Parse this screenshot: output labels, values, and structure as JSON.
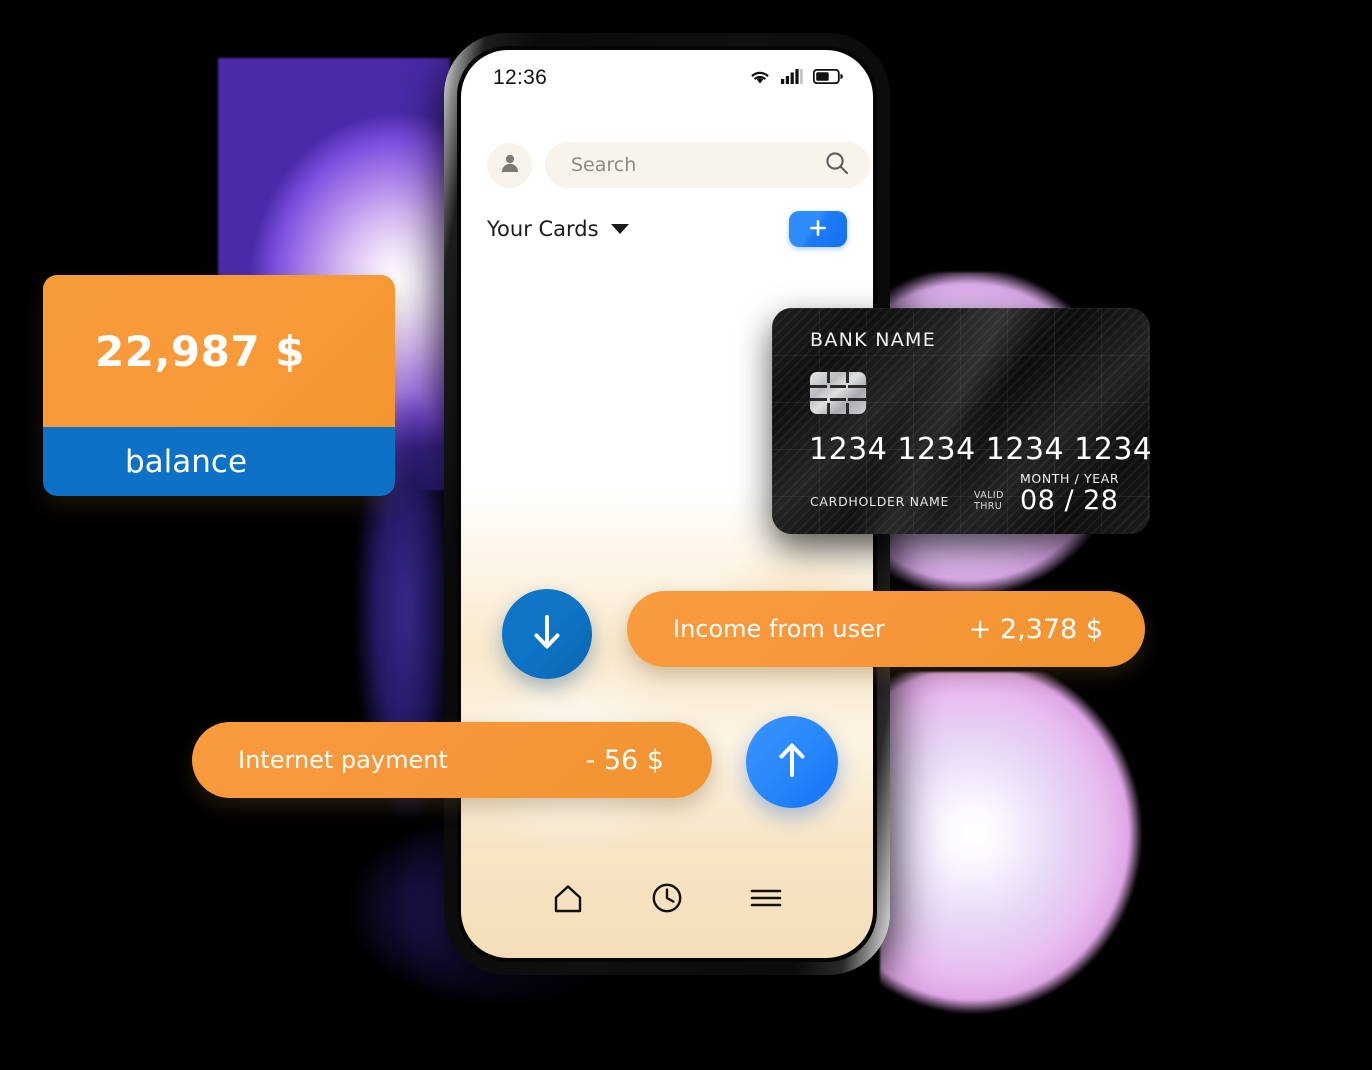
{
  "status_bar": {
    "time": "12:36",
    "icons": [
      "wifi-icon",
      "cellular-signal-icon",
      "battery-icon"
    ]
  },
  "search": {
    "placeholder": "Search",
    "value": "",
    "avatar_icon": "person-icon",
    "search_icon": "magnifier-icon"
  },
  "cards_header": {
    "title": "Your Cards",
    "dropdown_icon": "chevron-down-icon",
    "add_label": "+"
  },
  "balance_card": {
    "amount": "22,987 $",
    "label": "balance",
    "amount_bg": "#f89a39",
    "label_bg": "#0d72c5"
  },
  "credit_card": {
    "bank_name": "BANK  NAME",
    "number": "1234 1234 1234 1234",
    "cardholder": "CARDHOLDER NAME",
    "valid_thru": "VALID\nTHRU",
    "valid_line1": "VALID",
    "valid_line2": "THRU",
    "expiry_label": "MONTH / YEAR",
    "expiry": "08 / 28",
    "chip_icon": "emv-chip-icon"
  },
  "transactions": [
    {
      "label": "Income from user",
      "amount": "+ 2,378 $",
      "direction_icon": "arrow-down-icon",
      "direction_color": "#0e74c6"
    },
    {
      "label": "Internet payment",
      "amount": "- 56 $",
      "direction_icon": "arrow-up-icon",
      "direction_color": "#2a8afa"
    }
  ],
  "bottom_nav": [
    {
      "icon": "home-icon"
    },
    {
      "icon": "clock-history-icon"
    },
    {
      "icon": "hamburger-menu-icon"
    }
  ],
  "theme": {
    "orange": "#f89a39",
    "blue_dark": "#0d72c5",
    "blue_bright": "#2a8afa",
    "screen_cream": "#f9e9cd"
  }
}
